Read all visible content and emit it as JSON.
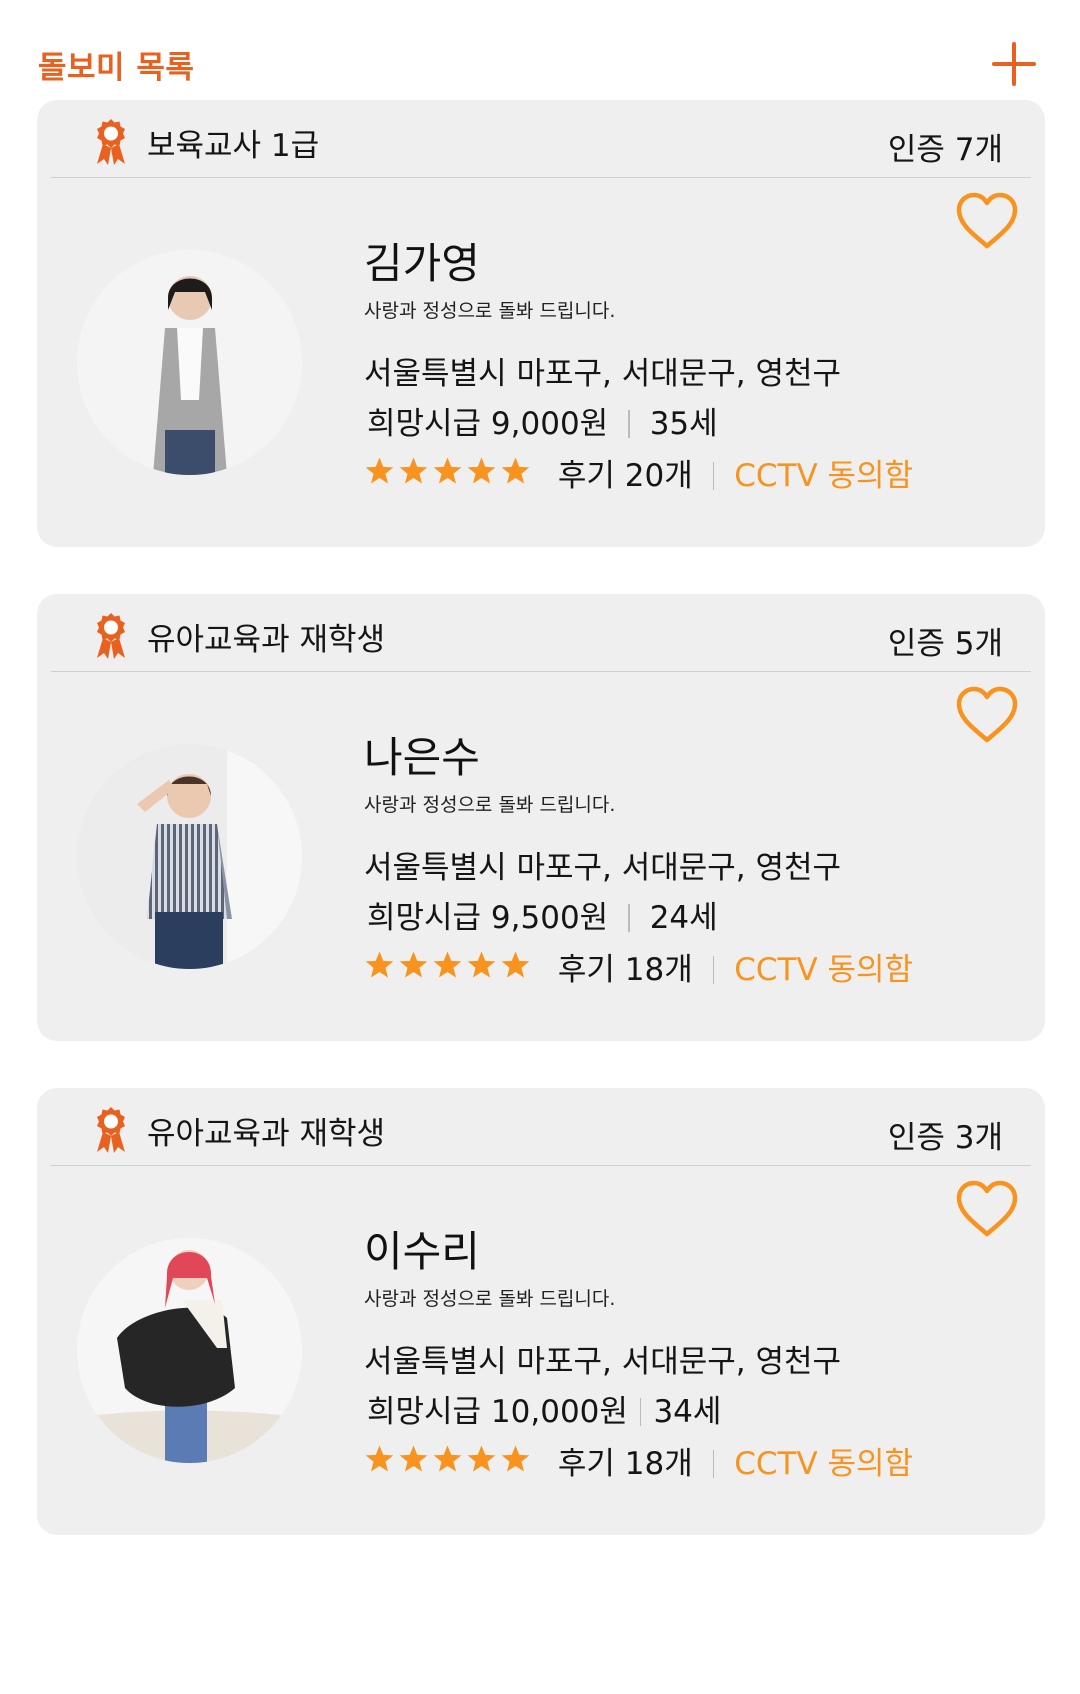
{
  "header": {
    "title": "돌보미 목록",
    "add_icon": "plus-icon"
  },
  "colors": {
    "accent": "#e8611f",
    "star": "#f7931e",
    "card_bg": "#efefef"
  },
  "sitters": [
    {
      "certification": "보육교사 1급",
      "cert_count": "인증 7개",
      "name": "김가영",
      "intro": "사랑과 정성으로 돌봐 드립니다.",
      "region": "서울특별시 마포구, 서대문구, 영천구",
      "wage": "희망시급 9,000원",
      "age": "35세",
      "rating": 5,
      "reviews": "후기 20개",
      "cctv": "CCTV 동의함"
    },
    {
      "certification": "유아교육과 재학생",
      "cert_count": "인증 5개",
      "name": "나은수",
      "intro": "사랑과 정성으로 돌봐 드립니다.",
      "region": "서울특별시 마포구, 서대문구, 영천구",
      "wage": "희망시급 9,500원",
      "age": "24세",
      "rating": 5,
      "reviews": "후기 18개",
      "cctv": "CCTV 동의함"
    },
    {
      "certification": "유아교육과 재학생",
      "cert_count": "인증 3개",
      "name": "이수리",
      "intro": "사랑과 정성으로 돌봐 드립니다.",
      "region": "서울특별시 마포구, 서대문구, 영천구",
      "wage": "희망시급 10,000원",
      "age": "34세",
      "rating": 5,
      "reviews": "후기 18개",
      "cctv": "CCTV 동의함"
    }
  ]
}
